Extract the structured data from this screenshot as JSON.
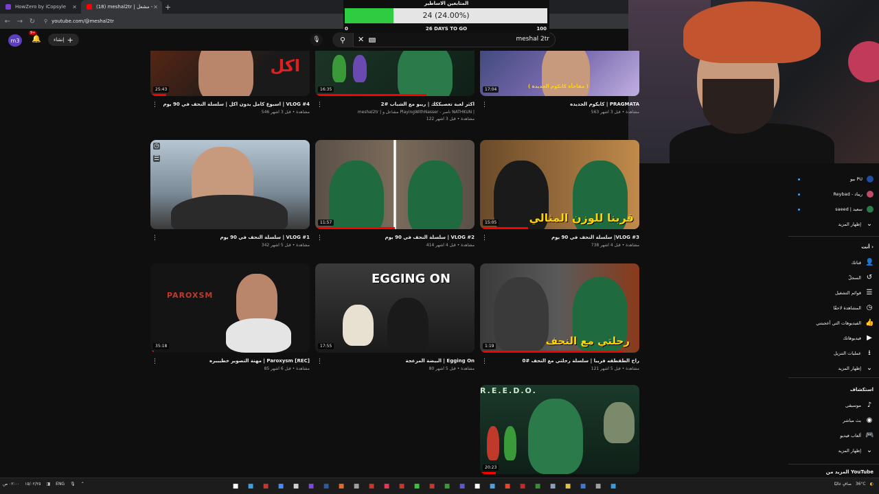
{
  "browser": {
    "tabs": [
      {
        "label": "HowZero by iCopsyle",
        "active": false
      },
      {
        "label": "(18) meshal2tr | مشعل - YouTube",
        "active": true
      }
    ],
    "new_tab": "+",
    "url": "youtube.com/@meshal2tr"
  },
  "subscriber_widget": {
    "title": "المتابعين الاساطير",
    "value_text": "24 (24.00%)",
    "progress": 0.24,
    "min": "0",
    "max": "100",
    "days_left": "26 DAYS TO GO"
  },
  "header": {
    "avatar_initials": "m3",
    "notifications_count": "9+",
    "create_label": "إنشاء",
    "search_value": "meshal 2tr"
  },
  "videos": [
    {
      "title": "اسبوع كامل بدون اكل | سلسلة النحف في 90 يوم | VLOG #4",
      "line2": "546 مشاهدة • قبل 3 أشهر",
      "line3": "",
      "duration": "25:43",
      "thumb_text": "اكل",
      "progress": 0.1
    },
    {
      "title": "اكثر لعبة تعصبككك | ريبو مع الشباب #2",
      "line2": "meshal2tr | مشاعل و PlayingWithNasser - ناصر NATHKUN |",
      "line3": "122 مشاهدة • قبل 3 أشهر",
      "duration": "16:35",
      "thumb_text": "",
      "progress": 0.7
    },
    {
      "title": "كابكوم الجديده | PRAGMATA",
      "line2": "563 مشاهدة • قبل 3 أشهر",
      "line3": "",
      "duration": "17:04",
      "thumb_text": "( مفاجأة كابكوم الجديدة )",
      "progress": 0.0
    },
    {
      "title": "سلسلة النحف في 90 يوم | VLOG #1",
      "line2": "342 مشاهدة • قبل 5 أشهر",
      "line3": "",
      "duration": "",
      "thumb_text": "",
      "progress": 0.0
    },
    {
      "title": "سلسلة النحف في 90 يوم | VLOG #2",
      "line2": "414 مشاهدة • قبل 4 أشهر",
      "line3": "",
      "duration": "11:57",
      "thumb_text": "",
      "progress": 0.5
    },
    {
      "title": "سلسلة النحف في 90 يوم |VLOG #3",
      "line2": "738 مشاهدة • قبل 4 أشهر",
      "line3": "",
      "duration": "15:05",
      "thumb_text": "قربنا للوزن المثالي",
      "progress": 0.3
    },
    {
      "title": "مهنة التصوير خطيييره | Paroxysm [REC]",
      "line2": "85 مشاهدة • قبل 6 أشهر",
      "line3": "",
      "duration": "35:18",
      "thumb_text": "PAROXSM",
      "progress": 0.02
    },
    {
      "title": "البيضة المزعجة | Egging On",
      "line2": "80 مشاهدة • قبل 5 أشهر",
      "line3": "",
      "duration": "17:55",
      "thumb_text": "EGGING ON",
      "progress": 0.0
    },
    {
      "title": "راح الطقطقه قريبا | سلسلة رحلتي مع النحف #0",
      "line2": "121 مشاهدة • قبل 5 أشهر",
      "line3": "",
      "duration": "1:19",
      "thumb_text": "رحلتي مع النحف",
      "progress": 0.9
    },
    {
      "title": "",
      "line2": "",
      "line3": "",
      "duration": "20:23",
      "thumb_text": "R.E.E.D.O.",
      "progress": 0.1
    }
  ],
  "sidebar": {
    "subscriptions": [
      {
        "label": "بيو PU",
        "new": true,
        "color": "#1e4fa0"
      },
      {
        "label": "Reybad - ريباد",
        "new": true,
        "color": "#c04a6a"
      },
      {
        "label": "saeed | سعيد",
        "new": true,
        "color": "#2a7a4a"
      }
    ],
    "show_more": "إظهار المزيد",
    "you_header": "أنت",
    "you_items": [
      {
        "label": "قناتك",
        "icon": "👤"
      },
      {
        "label": "السجلّ",
        "icon": "↺"
      },
      {
        "label": "قوائم التشغيل",
        "icon": "☰"
      },
      {
        "label": "المشاهدة لاحقًا",
        "icon": "◷"
      },
      {
        "label": "الفيديوهات التي أعجبتني",
        "icon": "👍"
      },
      {
        "label": "فيديوهاتك",
        "icon": "▶"
      },
      {
        "label": "عمليات التنزيل",
        "icon": "⭳"
      },
      {
        "label": "إظهار المزيد",
        "icon": "⌄"
      }
    ],
    "explore_header": "استكشاف",
    "explore_items": [
      {
        "label": "موسيقى",
        "icon": "♪"
      },
      {
        "label": "بث مباشر",
        "icon": "◉"
      },
      {
        "label": "ألعاب فيديو",
        "icon": "🎮"
      },
      {
        "label": "إظهار المزيد",
        "icon": "⌄"
      }
    ],
    "more_from": "المزيد من YouTube"
  },
  "taskbar": {
    "date": "١٥/٠٢/٢٥",
    "time": "٠٢:٠٠ ص",
    "lang": "ENG",
    "weather": "36°C",
    "weather_desc": "صافٍ غالبًا"
  }
}
